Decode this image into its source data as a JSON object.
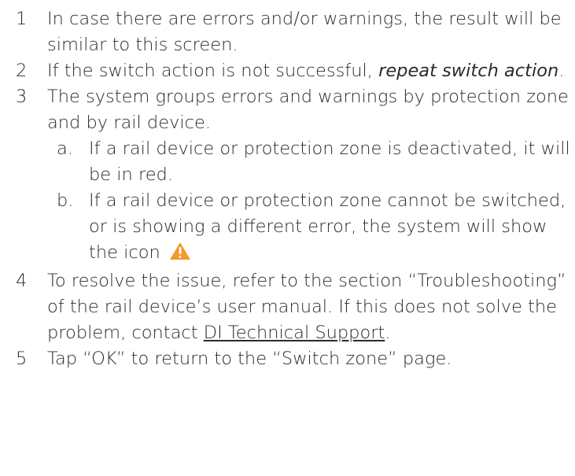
{
  "steps": [
    {
      "number": "1",
      "text": "In case there are errors and/or warnings, the result will be similar to this screen."
    },
    {
      "number": "2",
      "text_before": "If the switch action is not successful, ",
      "text_italic": "repeat switch action",
      "text_after": "."
    },
    {
      "number": "3",
      "text": "The system groups errors and warnings by protection zone and by rail device.",
      "substeps": [
        {
          "letter": "a.",
          "text": "If a rail device or protection zone is deactivated, it will be in red."
        },
        {
          "letter": "b.",
          "text": "If a rail device or protection zone cannot be switched, or is showing a different error, the system will show the icon",
          "icon": "warning-triangle-icon"
        }
      ]
    },
    {
      "number": "4",
      "text_before": "To resolve the issue, refer to the section “Troubleshooting” of the rail device’s user manual. If this does not solve the problem, contact ",
      "link_text": "DI Technical Support",
      "text_after": "."
    },
    {
      "number": "5",
      "text": "Tap “OK” to return to the “Switch zone” page."
    }
  ],
  "colors": {
    "text": "#2b2b2b",
    "warning_icon": "#f39a2b",
    "warning_icon_mark": "#ffffff"
  }
}
